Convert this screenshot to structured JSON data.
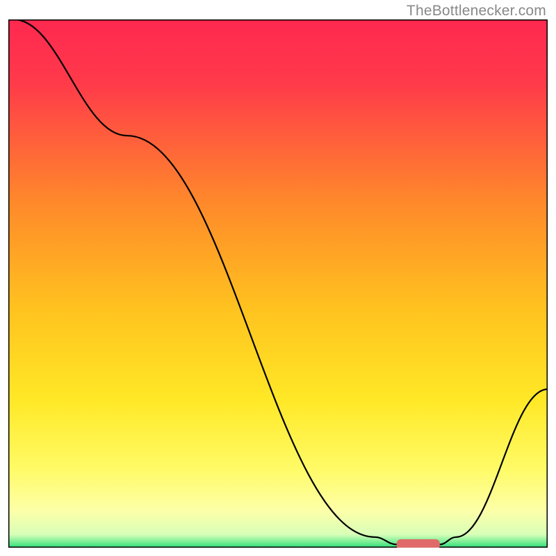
{
  "watermark": "TheBottlenecker.com",
  "chart_data": {
    "type": "line",
    "title": "",
    "xlabel": "",
    "ylabel": "",
    "xlim": [
      0,
      100
    ],
    "ylim": [
      0,
      100
    ],
    "grid": false,
    "legend": false,
    "background_gradient_stops": [
      {
        "offset": 0,
        "color": "#ff2850"
      },
      {
        "offset": 0.12,
        "color": "#ff3a4a"
      },
      {
        "offset": 0.35,
        "color": "#ff8a2a"
      },
      {
        "offset": 0.55,
        "color": "#ffc31f"
      },
      {
        "offset": 0.72,
        "color": "#ffe826"
      },
      {
        "offset": 0.85,
        "color": "#fffb66"
      },
      {
        "offset": 0.93,
        "color": "#fdffa8"
      },
      {
        "offset": 0.975,
        "color": "#d8ffb8"
      },
      {
        "offset": 1.0,
        "color": "#2fe07a"
      }
    ],
    "series": [
      {
        "name": "curve",
        "color": "#000000",
        "points_xy": [
          [
            1,
            100
          ],
          [
            22,
            78
          ],
          [
            68,
            2
          ],
          [
            72,
            0.6
          ],
          [
            80,
            0.6
          ],
          [
            83,
            2
          ],
          [
            100,
            30
          ]
        ]
      }
    ],
    "marker": {
      "color": "#e06a6a",
      "x_start": 72,
      "x_end": 80,
      "y": 0.6,
      "thickness": 2.0
    }
  }
}
